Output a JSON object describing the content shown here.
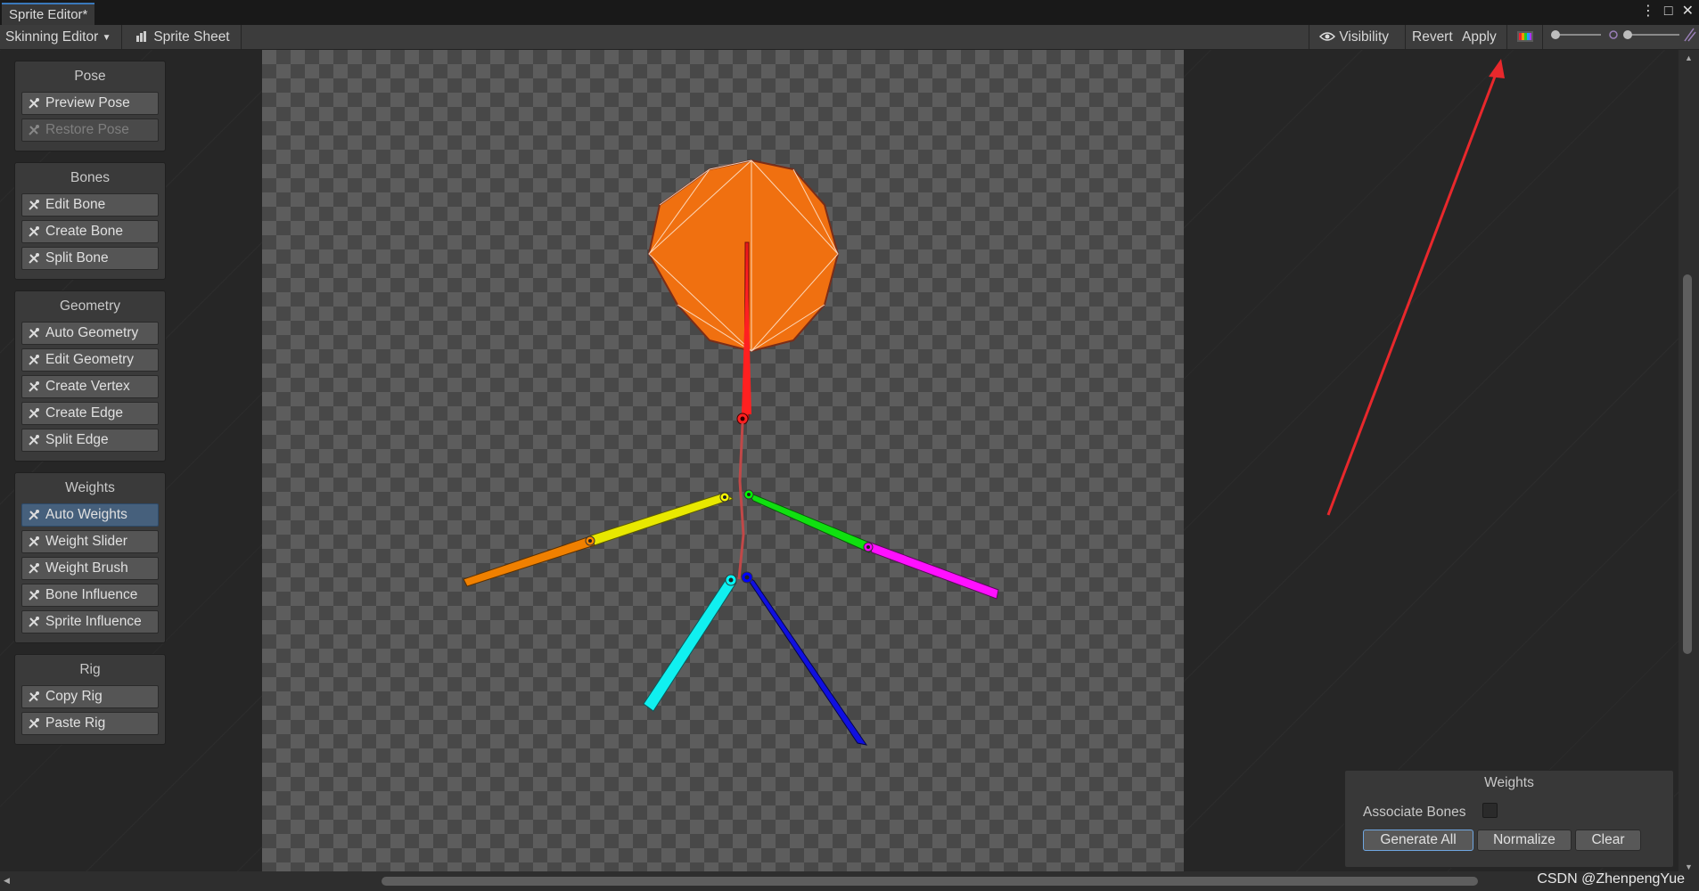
{
  "window": {
    "tab_title": "Sprite Editor*",
    "controls": {
      "menu": "⋮",
      "maximize": "□",
      "close": "✕"
    }
  },
  "toolbar": {
    "mode_label": "Skinning Editor",
    "sprite_sheet_label": "Sprite Sheet",
    "visibility_label": "Visibility",
    "revert_label": "Revert",
    "apply_label": "Apply"
  },
  "panels": [
    {
      "title": "Pose",
      "buttons": [
        {
          "label": "Preview Pose",
          "state": "normal",
          "icon": "pose-icon"
        },
        {
          "label": "Restore Pose",
          "state": "disabled",
          "icon": "restore-pose-icon"
        }
      ]
    },
    {
      "title": "Bones",
      "buttons": [
        {
          "label": "Edit Bone",
          "state": "normal",
          "icon": "edit-bone-icon"
        },
        {
          "label": "Create Bone",
          "state": "normal",
          "icon": "create-bone-icon"
        },
        {
          "label": "Split Bone",
          "state": "normal",
          "icon": "split-bone-icon"
        }
      ]
    },
    {
      "title": "Geometry",
      "buttons": [
        {
          "label": "Auto Geometry",
          "state": "normal",
          "icon": "auto-geometry-icon"
        },
        {
          "label": "Edit Geometry",
          "state": "normal",
          "icon": "edit-geometry-icon"
        },
        {
          "label": "Create Vertex",
          "state": "normal",
          "icon": "create-vertex-icon"
        },
        {
          "label": "Create Edge",
          "state": "normal",
          "icon": "create-edge-icon"
        },
        {
          "label": "Split Edge",
          "state": "normal",
          "icon": "split-edge-icon"
        }
      ]
    },
    {
      "title": "Weights",
      "buttons": [
        {
          "label": "Auto Weights",
          "state": "active",
          "icon": "auto-weights-icon"
        },
        {
          "label": "Weight Slider",
          "state": "normal",
          "icon": "weight-slider-icon"
        },
        {
          "label": "Weight Brush",
          "state": "normal",
          "icon": "weight-brush-icon"
        },
        {
          "label": "Bone Influence",
          "state": "normal",
          "icon": "bone-influence-icon"
        },
        {
          "label": "Sprite Influence",
          "state": "normal",
          "icon": "sprite-influence-icon"
        }
      ]
    },
    {
      "title": "Rig",
      "buttons": [
        {
          "label": "Copy Rig",
          "state": "normal",
          "icon": "copy-rig-icon"
        },
        {
          "label": "Paste Rig",
          "state": "normal",
          "icon": "paste-rig-icon"
        }
      ]
    }
  ],
  "weights_panel": {
    "title": "Weights",
    "associate_bones_label": "Associate Bones",
    "associate_bones_checked": false,
    "generate_all_label": "Generate All",
    "normalize_label": "Normalize",
    "clear_label": "Clear"
  },
  "colors": {
    "head": "#f07010",
    "bones": [
      "#ff1010",
      "#ffff00",
      "#ff8800",
      "#00ff00",
      "#ff00ff",
      "#00ffff",
      "#0000ff"
    ],
    "annotation_arrow": "#e8282c",
    "accent": "#3a79bb"
  },
  "watermark": "CSDN @ZhenpengYue"
}
